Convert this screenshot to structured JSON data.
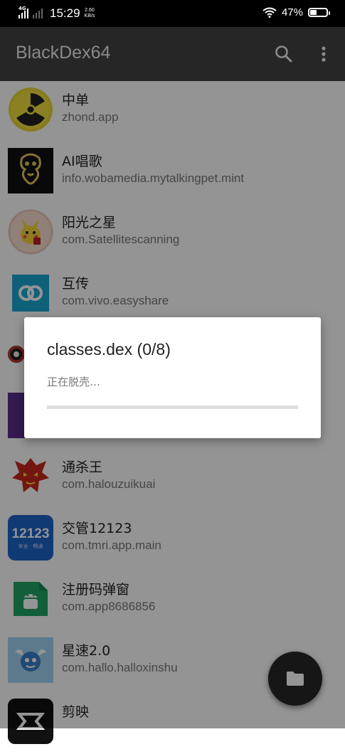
{
  "status_bar": {
    "network": "4G",
    "time": "15:29",
    "speed_value": "2.60",
    "speed_unit": "KB/s",
    "battery": "47%",
    "battery_level": 0.47
  },
  "app_bar": {
    "title": "BlackDex64",
    "search_icon": "search-icon",
    "more_icon": "more-vert-icon"
  },
  "apps": [
    {
      "name": "中单",
      "package": "zhond.app"
    },
    {
      "name": "AI唱歌",
      "package": "info.wobamedia.mytalkingpet.mint"
    },
    {
      "name": "阳光之星",
      "package": "com.Satellitescanning"
    },
    {
      "name": "互传",
      "package": "com.vivo.easyshare"
    },
    {
      "name": "",
      "package": ""
    },
    {
      "name": "",
      "package": ""
    },
    {
      "name": "通杀王",
      "package": "com.halouzuikuai"
    },
    {
      "name": "交管12123",
      "package": "com.tmri.app.main"
    },
    {
      "name": "注册码弹窗",
      "package": "com.app8686856"
    },
    {
      "name": "星速2.0",
      "package": "com.hallo.halloxinshu"
    },
    {
      "name": "剪映",
      "package": ""
    }
  ],
  "icon_text": {
    "jiaoguan_number": "12123",
    "jiaoguan_motto": "安全 · 畅通"
  },
  "dialog": {
    "title": "classes.dex (0/8)",
    "message": "正在脱壳…",
    "progress": 0.0
  },
  "fab": {
    "icon": "folder-icon"
  },
  "colors": {
    "appbar": "#262626",
    "statusbar": "#000000",
    "scrim": "rgba(0,0,0,0.42)",
    "dialog_bg": "#ffffff"
  }
}
